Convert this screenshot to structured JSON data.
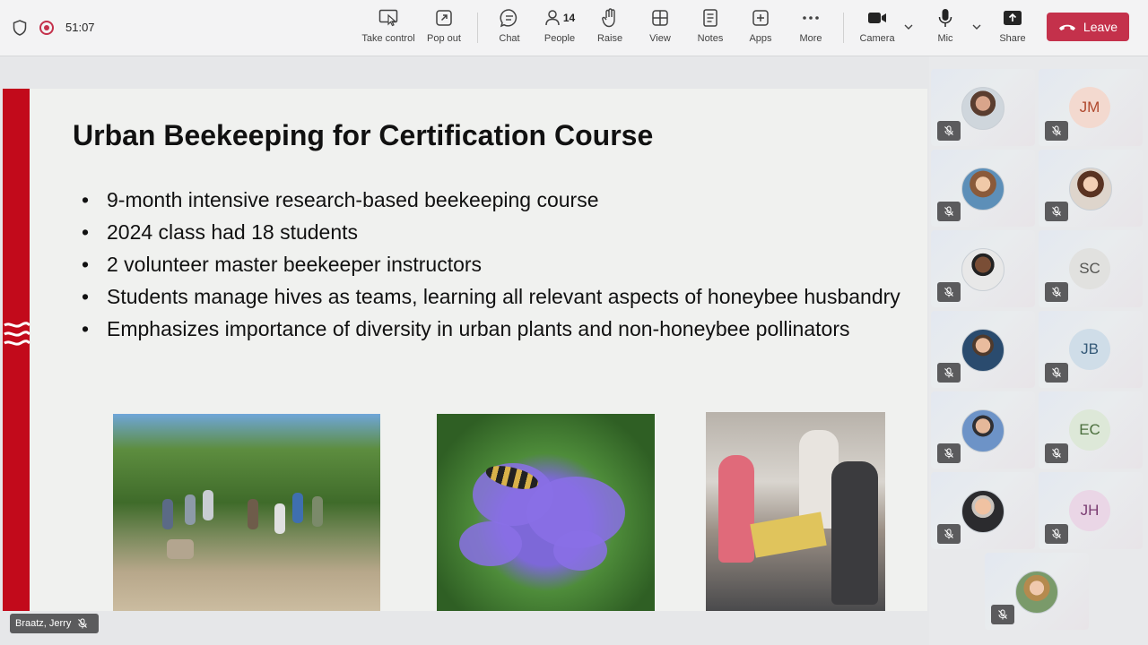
{
  "meeting": {
    "elapsed_time": "51:07"
  },
  "toolbar": {
    "take_control": "Take control",
    "pop_out": "Pop out",
    "chat": "Chat",
    "people": "People",
    "people_count": "14",
    "raise": "Raise",
    "view": "View",
    "notes": "Notes",
    "apps": "Apps",
    "more": "More",
    "camera": "Camera",
    "mic": "Mic",
    "share": "Share",
    "leave": "Leave",
    "leave_color": "#c4314b"
  },
  "slide": {
    "title": "Urban Beekeeping for Certification Course",
    "bullets": [
      "9-month intensive research-based  beekeeping course",
      "2024 class had 18 students",
      "2 volunteer master beekeeper instructors",
      "Students manage hives as teams, learning all relevant aspects of honeybee husbandry",
      "Emphasizes importance of diversity in urban plants and non-honeybee pollinators"
    ],
    "accent_color": "#c20a1b"
  },
  "presenter": {
    "name": "Braatz, Jerry"
  },
  "participants": [
    {
      "initials": "",
      "avatar": "photo",
      "muted": true
    },
    {
      "initials": "JM",
      "avatar": "initials",
      "color": "#f3d9cf",
      "text_color": "#b0492e",
      "muted": true
    },
    {
      "initials": "",
      "avatar": "photo",
      "muted": true
    },
    {
      "initials": "",
      "avatar": "photo",
      "muted": true
    },
    {
      "initials": "",
      "avatar": "photo",
      "muted": true
    },
    {
      "initials": "SC",
      "avatar": "initials",
      "color": "#e1e1df",
      "text_color": "#555552",
      "muted": true
    },
    {
      "initials": "",
      "avatar": "photo",
      "muted": true
    },
    {
      "initials": "JB",
      "avatar": "initials",
      "color": "#cfdde8",
      "text_color": "#355a78",
      "muted": true
    },
    {
      "initials": "",
      "avatar": "photo",
      "muted": true
    },
    {
      "initials": "EC",
      "avatar": "initials",
      "color": "#dde8d8",
      "text_color": "#4a6e3c",
      "muted": true
    },
    {
      "initials": "",
      "avatar": "photo",
      "muted": true
    },
    {
      "initials": "JH",
      "avatar": "initials",
      "color": "#ead6e6",
      "text_color": "#7b3d72",
      "muted": true
    },
    {
      "initials": "",
      "avatar": "photo",
      "muted": true
    }
  ]
}
